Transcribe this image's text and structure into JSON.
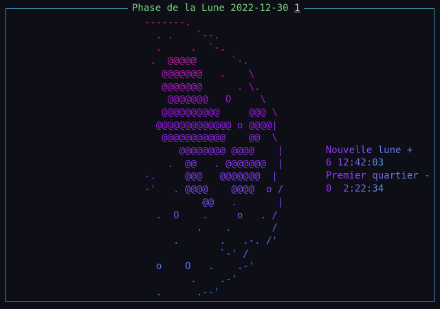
{
  "title": {
    "text": "Phase de la Lune 2022-12-30",
    "page": "1"
  },
  "moon": {
    "lines": [
      "-------.",
      "  . .    `--.",
      "  .     .  `-.",
      " .  @@@@@      `-.",
      "   @@@@@@@   .    \\",
      "   @@@@@@@      . \\.",
      "    @@@@@@@   O     \\",
      "   @@@@@@@@@@     @@@ \\",
      "  @@@@@@@@@@@@@ o @@@@|",
      "   @@@@@@@@@@@    @@  \\",
      "      @@@@@@@@ @@@@    |",
      "    .  @@   . @@@@@@@  |",
      "-.     @@@   @@@@@@@  |",
      "-'   . @@@@    @@@@  o /",
      "          @@   .       |",
      "  .  O    .     o   . /",
      "         .    .       /",
      "     .       .   .-. /'",
      "             `-' /",
      "  o    O   .    .-'",
      "        .    .-'",
      "  .      .--'"
    ],
    "colors": [
      "#e0207a",
      "#9a18e8",
      "#7a4cf0",
      "#3a8ef0"
    ]
  },
  "info": {
    "next_phase_1": "Nouvelle lune +",
    "time_1": "6 12:42:03",
    "next_phase_2": "Premier quartier -",
    "time_2": "0  2:22:34",
    "color_1": "#9e2ff5",
    "color_2": "#5599ee"
  }
}
